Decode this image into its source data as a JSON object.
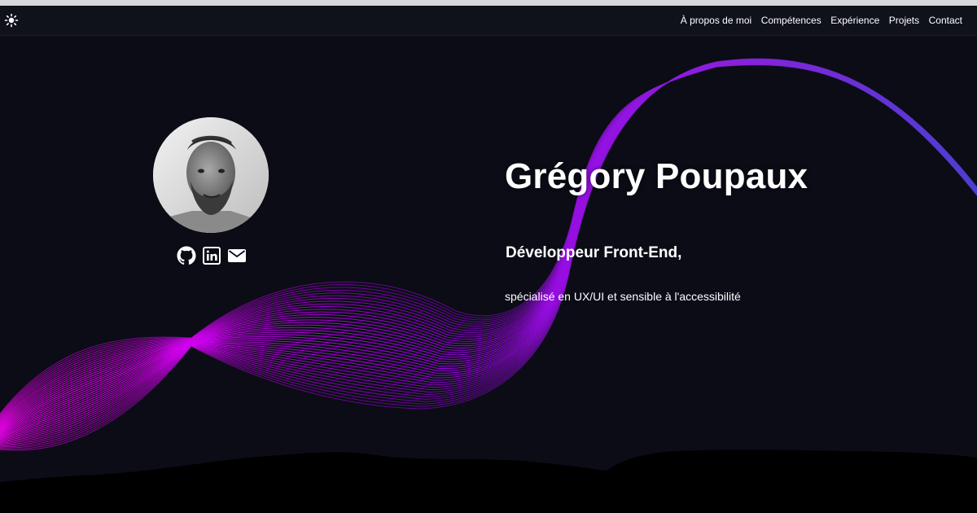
{
  "nav": {
    "theme_toggle_icon": "sun-icon",
    "links": [
      "À propos de moi",
      "Compétences",
      "Expérience",
      "Projets",
      "Contact"
    ]
  },
  "hero": {
    "name": "Grégory Poupaux",
    "role": "Développeur Front-End,",
    "specialty": "spécialisé en UX/UI et sensible à l'accessibilité"
  },
  "socials": [
    {
      "icon": "github-icon"
    },
    {
      "icon": "linkedin-icon"
    },
    {
      "icon": "mail-icon"
    }
  ],
  "colors": {
    "background": "#0b0c16",
    "navbar": "#0f111b",
    "wave_start": "#e600e6",
    "wave_end": "#5a3ad6",
    "text": "#ffffff"
  }
}
